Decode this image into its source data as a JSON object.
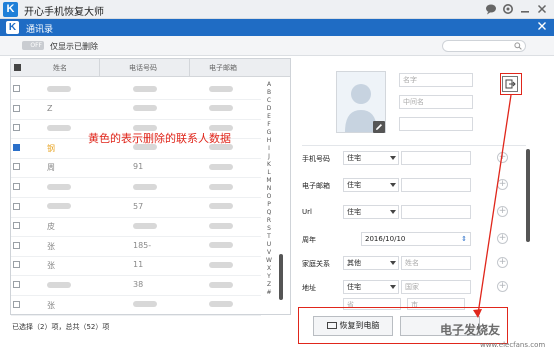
{
  "app": {
    "logo": "K",
    "title": "开心手机恢复大师"
  },
  "dialog": {
    "logo": "K",
    "title": "通讯录"
  },
  "toolbar": {
    "toggle_state": "OFF",
    "toggle_label": "仅显示已删除"
  },
  "table": {
    "headers": {
      "name": "姓名",
      "phone": "电话号码",
      "email": "电子邮箱"
    },
    "rows": [
      {
        "name": "",
        "phone": "",
        "email": "",
        "checked": false,
        "deleted": false
      },
      {
        "name": "Z",
        "phone": "",
        "email": "",
        "checked": false,
        "deleted": false
      },
      {
        "name": "",
        "phone": "",
        "email": "",
        "checked": false,
        "deleted": false
      },
      {
        "name": "钢",
        "phone": "",
        "email": "",
        "checked": true,
        "deleted": true
      },
      {
        "name": "周",
        "phone": "91",
        "email": "",
        "checked": false,
        "deleted": false
      },
      {
        "name": "",
        "phone": "",
        "email": "",
        "checked": false,
        "deleted": false
      },
      {
        "name": "",
        "phone": "57",
        "email": "",
        "checked": false,
        "deleted": false
      },
      {
        "name": "皮",
        "phone": "",
        "email": "",
        "checked": false,
        "deleted": false
      },
      {
        "name": "张",
        "phone": "185-",
        "email": "",
        "checked": false,
        "deleted": false
      },
      {
        "name": "张",
        "phone": "11",
        "email": "",
        "checked": false,
        "deleted": false
      },
      {
        "name": "",
        "phone": "38",
        "email": "",
        "checked": false,
        "deleted": false
      },
      {
        "name": "张",
        "phone": "",
        "email": "",
        "checked": false,
        "deleted": false
      }
    ],
    "index_letters": [
      "A",
      "B",
      "C",
      "D",
      "E",
      "F",
      "G",
      "H",
      "I",
      "J",
      "K",
      "L",
      "M",
      "N",
      "O",
      "P",
      "Q",
      "R",
      "S",
      "T",
      "U",
      "V",
      "W",
      "X",
      "Y",
      "Z",
      "#"
    ]
  },
  "status": "已选择（2）项，总共（52）项",
  "annotation": "黄色的表示删除的联系人数据",
  "detail": {
    "placeholders": {
      "name": "名字",
      "middle_name": "中间名"
    },
    "fields": [
      {
        "label": "手机号码",
        "type": "住宅",
        "value": ""
      },
      {
        "label": "电子邮箱",
        "type": "住宅",
        "value": ""
      },
      {
        "label": "Url",
        "type": "住宅",
        "value": ""
      },
      {
        "label": "周年",
        "type": "",
        "value": "2016/10/10"
      },
      {
        "label": "家庭关系",
        "type": "其他",
        "value": "姓名"
      },
      {
        "label": "地址",
        "type": "住宅",
        "value": "国家"
      }
    ],
    "address_extra": [
      "省",
      "市"
    ]
  },
  "buttons": {
    "restore": "恢复到电脑"
  },
  "watermark": {
    "main": "电子发烧友",
    "sub": "www.elecfans.com"
  },
  "colors": {
    "accent": "#1f6cc4",
    "deleted": "#e8a628",
    "annotation": "#e0261b"
  },
  "icons": [
    "app-logo-icon",
    "message-icon",
    "settings-icon",
    "minimize-icon",
    "close-icon",
    "search-icon",
    "edit-icon",
    "export-icon",
    "plus-icon",
    "computer-icon"
  ]
}
